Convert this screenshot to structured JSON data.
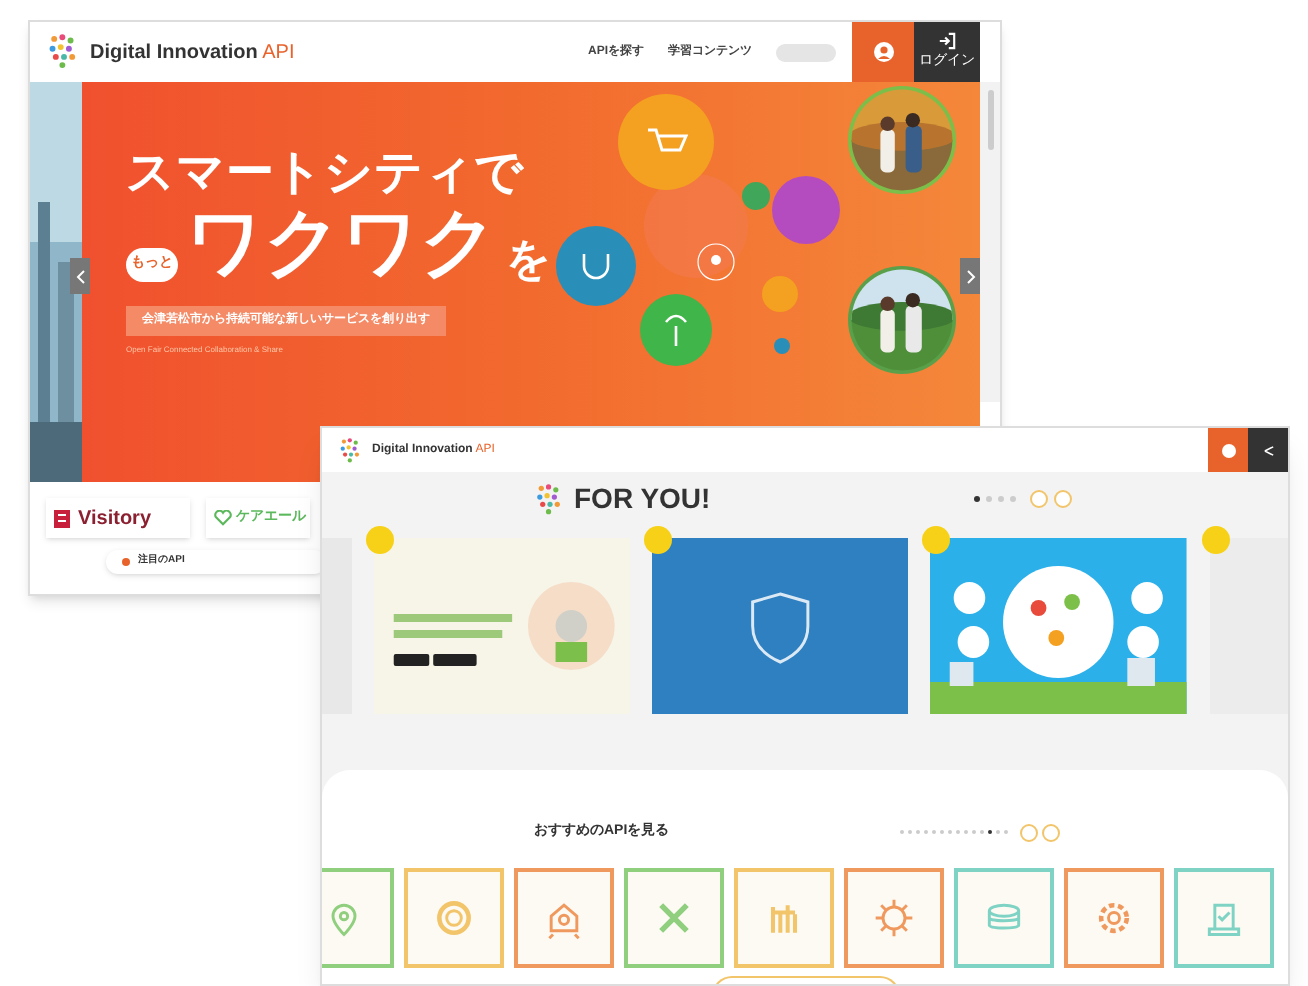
{
  "window_back": {
    "header": {
      "title_bold": "Digital Innovation",
      "title_light": "API",
      "nav": [
        "APIを探す",
        "学習コンテンツ"
      ],
      "login": "ログイン"
    },
    "hero": {
      "headline_1": "スマートシティで",
      "bubble": "もっと",
      "headline_2": "ワクワク",
      "headline_2_tail": "を",
      "tagline": "会津若松市から持続可能な新しいサービスを創り出す",
      "subtitle": "Open Fair Connected Collaboration & Share"
    },
    "partner_logos": [
      "Visitory",
      "ケアエール"
    ],
    "featured": {
      "label": "注目のAPI"
    }
  },
  "window_front": {
    "header": {
      "title_bold": "Digital Innovation",
      "title_light": "API"
    },
    "for_you": {
      "title": "FOR YOU!",
      "pager": [
        {
          "selected": true
        },
        {
          "selected": false
        },
        {
          "selected": false
        },
        {
          "selected": false
        }
      ],
      "cards": [
        {
          "kind": "care"
        },
        {
          "kind": "shield"
        },
        {
          "kind": "food"
        }
      ]
    },
    "recommended": {
      "title": "おすすめのAPIを見る",
      "pager": [
        {
          "selected": false
        },
        {
          "selected": false
        },
        {
          "selected": false
        },
        {
          "selected": false
        },
        {
          "selected": false
        },
        {
          "selected": false
        },
        {
          "selected": false
        },
        {
          "selected": false
        },
        {
          "selected": false
        },
        {
          "selected": false
        },
        {
          "selected": false
        },
        {
          "selected": true
        },
        {
          "selected": false
        },
        {
          "selected": false
        }
      ],
      "tiles": [
        {
          "kind": "pin",
          "color": "#8fcf7e"
        },
        {
          "kind": "ring",
          "color": "#f2c56b"
        },
        {
          "kind": "house",
          "color": "#f0995e"
        },
        {
          "kind": "cross",
          "color": "#8fcf7e"
        },
        {
          "kind": "bars",
          "color": "#f2c56b"
        },
        {
          "kind": "sun",
          "color": "#f0995e"
        },
        {
          "kind": "stack",
          "color": "#7fd3c4"
        },
        {
          "kind": "gear",
          "color": "#f0995e"
        },
        {
          "kind": "ballot",
          "color": "#7fd3c4"
        }
      ]
    }
  }
}
